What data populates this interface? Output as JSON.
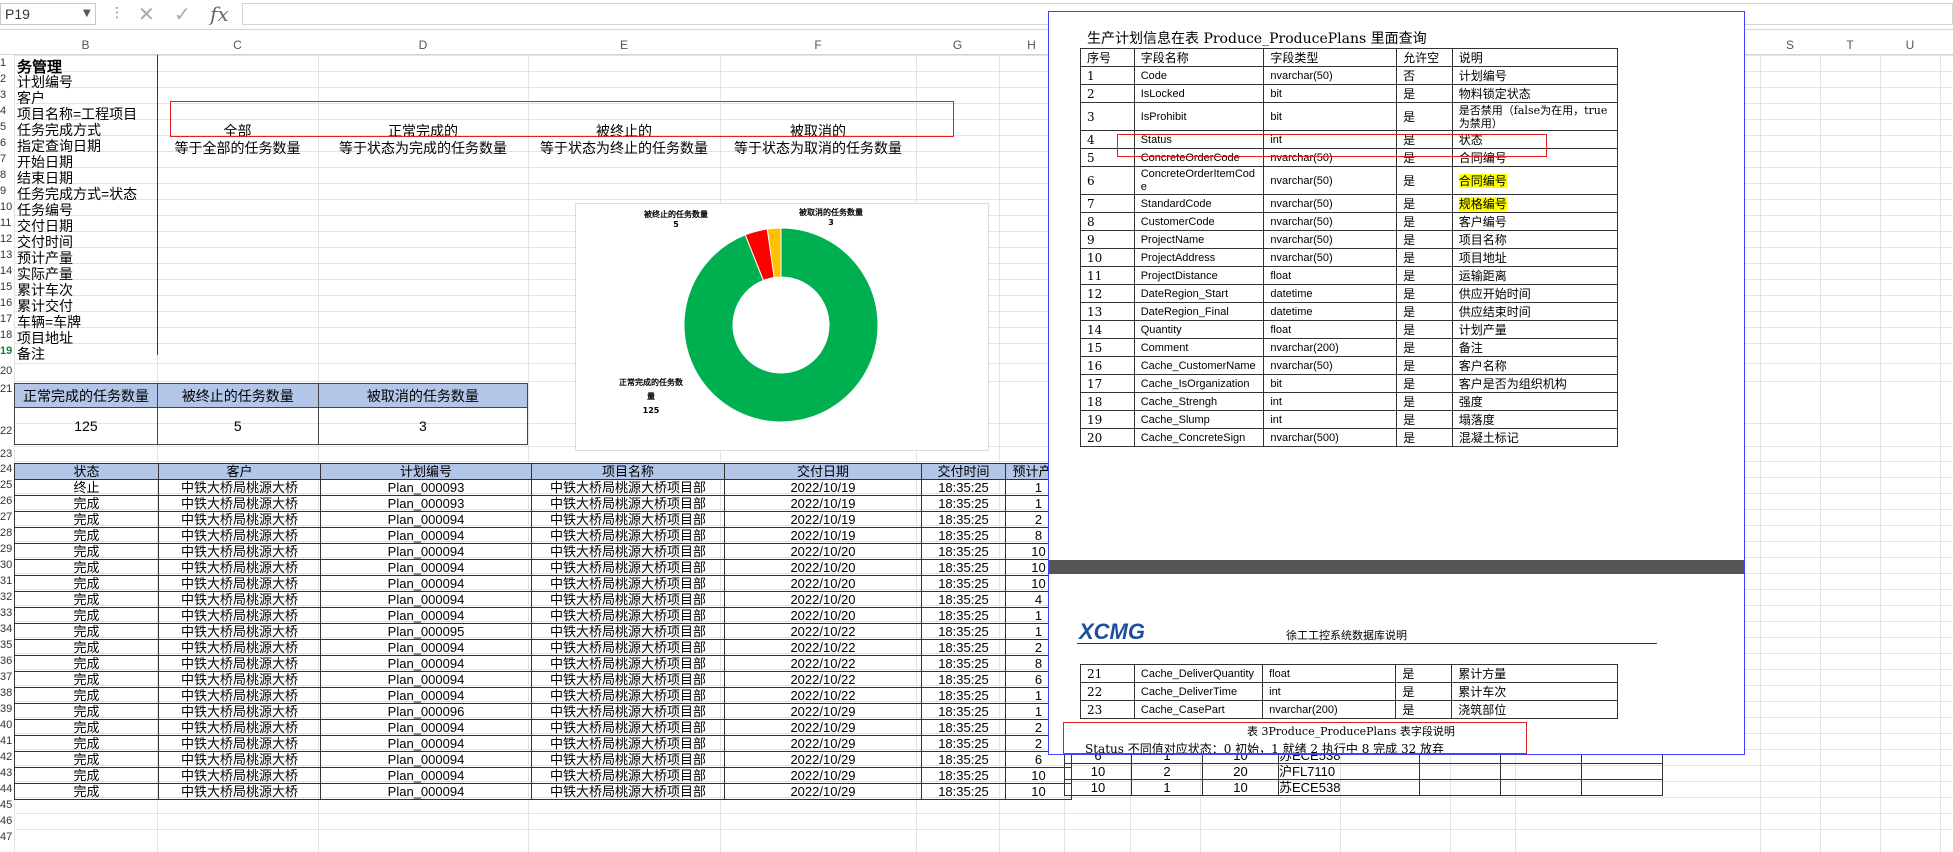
{
  "formula_bar": {
    "name_box": "P19",
    "dots": "⋮",
    "cancel_icon": "✕",
    "confirm_icon": "✓",
    "fx": "fx",
    "value": ""
  },
  "columns": [
    "B",
    "C",
    "D",
    "E",
    "F",
    "G",
    "H",
    "S",
    "T",
    "U"
  ],
  "rows": [
    "1",
    "2",
    "3",
    "4",
    "5",
    "6",
    "7",
    "8",
    "9",
    "10",
    "11",
    "12",
    "13",
    "14",
    "15",
    "16",
    "17",
    "18",
    "19",
    "20",
    "21",
    "22",
    "23",
    "24",
    "25",
    "26",
    "27",
    "28",
    "29",
    "30",
    "31",
    "32",
    "33",
    "34",
    "35",
    "36",
    "37",
    "38",
    "39",
    "40",
    "41",
    "42",
    "43",
    "44",
    "45",
    "46",
    "47"
  ],
  "colB_items": [
    "务管理",
    "计划编号",
    "客户",
    "项目名称=工程项目",
    "任务完成方式",
    "指定查询日期",
    "开始日期",
    "结束日期",
    "任务完成方式=状态",
    "任务编号",
    "交付日期",
    "交付时间",
    "预计产量",
    "实际产量",
    "累计车次",
    "累计交付",
    "车辆=车牌",
    "项目地址",
    "备注"
  ],
  "header_row5": [
    "全部",
    "正常完成的",
    "被终止的",
    "被取消的"
  ],
  "header_row6": [
    "等于全部的任务数量",
    "等于状态为完成的任务数量",
    "等于状态为终止的任务数量",
    "等于状态为取消的任务数量"
  ],
  "summary": {
    "headers": [
      "正常完成的任务数量",
      "被终止的任务数量",
      "被取消的任务数量"
    ],
    "values": [
      "125",
      "5",
      "3"
    ]
  },
  "chart_data": {
    "type": "pie",
    "donut": true,
    "categories": [
      "正常完成的任务数量",
      "被终止的任务数量",
      "被取消的任务数量"
    ],
    "values": [
      125,
      5,
      3
    ],
    "colors": [
      "#00b050",
      "#ff0000",
      "#ffc000"
    ],
    "labels": [
      {
        "name": "被终止的任务数量",
        "value": "5"
      },
      {
        "name": "被取消的任务数量",
        "value": "3"
      },
      {
        "name": "正常完成的任务数",
        "name2": "量",
        "value": "125"
      }
    ]
  },
  "main_table": {
    "headers": [
      "状态",
      "客户",
      "计划编号",
      "项目名称",
      "交付日期",
      "交付时间",
      "预计产量"
    ],
    "rows": [
      [
        "终止",
        "中铁大桥局桃源大桥",
        "Plan_000093",
        "中铁大桥局桃源大桥项目部",
        "2022/10/19",
        "18:35:25",
        "1"
      ],
      [
        "完成",
        "中铁大桥局桃源大桥",
        "Plan_000093",
        "中铁大桥局桃源大桥项目部",
        "2022/10/19",
        "18:35:25",
        "1"
      ],
      [
        "完成",
        "中铁大桥局桃源大桥",
        "Plan_000094",
        "中铁大桥局桃源大桥项目部",
        "2022/10/19",
        "18:35:25",
        "2"
      ],
      [
        "完成",
        "中铁大桥局桃源大桥",
        "Plan_000094",
        "中铁大桥局桃源大桥项目部",
        "2022/10/19",
        "18:35:25",
        "8"
      ],
      [
        "完成",
        "中铁大桥局桃源大桥",
        "Plan_000094",
        "中铁大桥局桃源大桥项目部",
        "2022/10/20",
        "18:35:25",
        "10"
      ],
      [
        "完成",
        "中铁大桥局桃源大桥",
        "Plan_000094",
        "中铁大桥局桃源大桥项目部",
        "2022/10/20",
        "18:35:25",
        "10"
      ],
      [
        "完成",
        "中铁大桥局桃源大桥",
        "Plan_000094",
        "中铁大桥局桃源大桥项目部",
        "2022/10/20",
        "18:35:25",
        "10"
      ],
      [
        "完成",
        "中铁大桥局桃源大桥",
        "Plan_000094",
        "中铁大桥局桃源大桥项目部",
        "2022/10/20",
        "18:35:25",
        "4"
      ],
      [
        "完成",
        "中铁大桥局桃源大桥",
        "Plan_000094",
        "中铁大桥局桃源大桥项目部",
        "2022/10/20",
        "18:35:25",
        "1"
      ],
      [
        "完成",
        "中铁大桥局桃源大桥",
        "Plan_000095",
        "中铁大桥局桃源大桥项目部",
        "2022/10/22",
        "18:35:25",
        "1"
      ],
      [
        "完成",
        "中铁大桥局桃源大桥",
        "Plan_000094",
        "中铁大桥局桃源大桥项目部",
        "2022/10/22",
        "18:35:25",
        "2"
      ],
      [
        "完成",
        "中铁大桥局桃源大桥",
        "Plan_000094",
        "中铁大桥局桃源大桥项目部",
        "2022/10/22",
        "18:35:25",
        "8"
      ],
      [
        "完成",
        "中铁大桥局桃源大桥",
        "Plan_000094",
        "中铁大桥局桃源大桥项目部",
        "2022/10/22",
        "18:35:25",
        "6"
      ],
      [
        "完成",
        "中铁大桥局桃源大桥",
        "Plan_000094",
        "中铁大桥局桃源大桥项目部",
        "2022/10/22",
        "18:35:25",
        "1"
      ],
      [
        "完成",
        "中铁大桥局桃源大桥",
        "Plan_000096",
        "中铁大桥局桃源大桥项目部",
        "2022/10/29",
        "18:35:25",
        "1"
      ],
      [
        "完成",
        "中铁大桥局桃源大桥",
        "Plan_000094",
        "中铁大桥局桃源大桥项目部",
        "2022/10/29",
        "18:35:25",
        "2"
      ],
      [
        "完成",
        "中铁大桥局桃源大桥",
        "Plan_000094",
        "中铁大桥局桃源大桥项目部",
        "2022/10/29",
        "18:35:25",
        "2"
      ],
      [
        "完成",
        "中铁大桥局桃源大桥",
        "Plan_000094",
        "中铁大桥局桃源大桥项目部",
        "2022/10/29",
        "18:35:25",
        "6"
      ],
      [
        "完成",
        "中铁大桥局桃源大桥",
        "Plan_000094",
        "中铁大桥局桃源大桥项目部",
        "2022/10/29",
        "18:35:25",
        "10"
      ],
      [
        "完成",
        "中铁大桥局桃源大桥",
        "Plan_000094",
        "中铁大桥局桃源大桥项目部",
        "2022/10/29",
        "18:35:25",
        "10"
      ]
    ],
    "extra_rows": [
      [
        "6",
        "1",
        "10",
        "苏ECE538"
      ],
      [
        "10",
        "2",
        "20",
        "沪FL7110"
      ],
      [
        "10",
        "1",
        "10",
        "苏ECE538"
      ]
    ]
  },
  "doc": {
    "title": "生产计划信息在表 Produce_ProducePlans 里面查询",
    "table_headers": [
      "序号",
      "字段名称",
      "字段类型",
      "允许空",
      "说明"
    ],
    "fields": [
      [
        "1",
        "Code",
        "nvarchar(50)",
        "否",
        "计划编号"
      ],
      [
        "2",
        "IsLocked",
        "bit",
        "是",
        "物料锁定状态"
      ],
      [
        "3",
        "IsProhibit",
        "bit",
        "是",
        "是否禁用（false为在用，true为禁用）"
      ],
      [
        "4",
        "Status",
        "int",
        "是",
        "状态"
      ],
      [
        "5",
        "ConcreteOrderCode",
        "nvarchar(50)",
        "是",
        "合同编号"
      ],
      [
        "6",
        "ConcreteOrderItemCode",
        "nvarchar(50)",
        "是",
        "合同编号"
      ],
      [
        "7",
        "StandardCode",
        "nvarchar(50)",
        "是",
        "规格编号"
      ],
      [
        "8",
        "CustomerCode",
        "nvarchar(50)",
        "是",
        "客户编号"
      ],
      [
        "9",
        "ProjectName",
        "nvarchar(50)",
        "是",
        "项目名称"
      ],
      [
        "10",
        "ProjectAddress",
        "nvarchar(50)",
        "是",
        "项目地址"
      ],
      [
        "11",
        "ProjectDistance",
        "float",
        "是",
        "运输距离"
      ],
      [
        "12",
        "DateRegion_Start",
        "datetime",
        "是",
        "供应开始时间"
      ],
      [
        "13",
        "DateRegion_Final",
        "datetime",
        "是",
        "供应结束时间"
      ],
      [
        "14",
        "Quantity",
        "float",
        "是",
        "计划产量"
      ],
      [
        "15",
        "Comment",
        "nvarchar(200)",
        "是",
        "备注"
      ],
      [
        "16",
        "Cache_CustomerName",
        "nvarchar(50)",
        "是",
        "客户名称"
      ],
      [
        "17",
        "Cache_IsOrganization",
        "bit",
        "是",
        "客户是否为组织机构"
      ],
      [
        "18",
        "Cache_Strengh",
        "int",
        "是",
        "强度"
      ],
      [
        "19",
        "Cache_Slump",
        "int",
        "是",
        "塌落度"
      ],
      [
        "20",
        "Cache_ConcreteSign",
        "nvarchar(500)",
        "是",
        "混凝土标记"
      ]
    ],
    "page2_logo": "XCMG",
    "page2_header": "徐工工控系统数据库说明",
    "page2_fields": [
      [
        "21",
        "Cache_DeliverQuantity",
        "float",
        "是",
        "累计方量"
      ],
      [
        "22",
        "Cache_DeliverTime",
        "int",
        "是",
        "累计车次"
      ],
      [
        "23",
        "Cache_CasePart",
        "nvarchar(200)",
        "是",
        "浇筑部位"
      ]
    ],
    "caption": "表 3Produce_ProducePlans 表字段说明",
    "status_note": "Status 不同值对应状态：0 初始，1 就绪 2 执行中 8 完成 32 放弃"
  }
}
